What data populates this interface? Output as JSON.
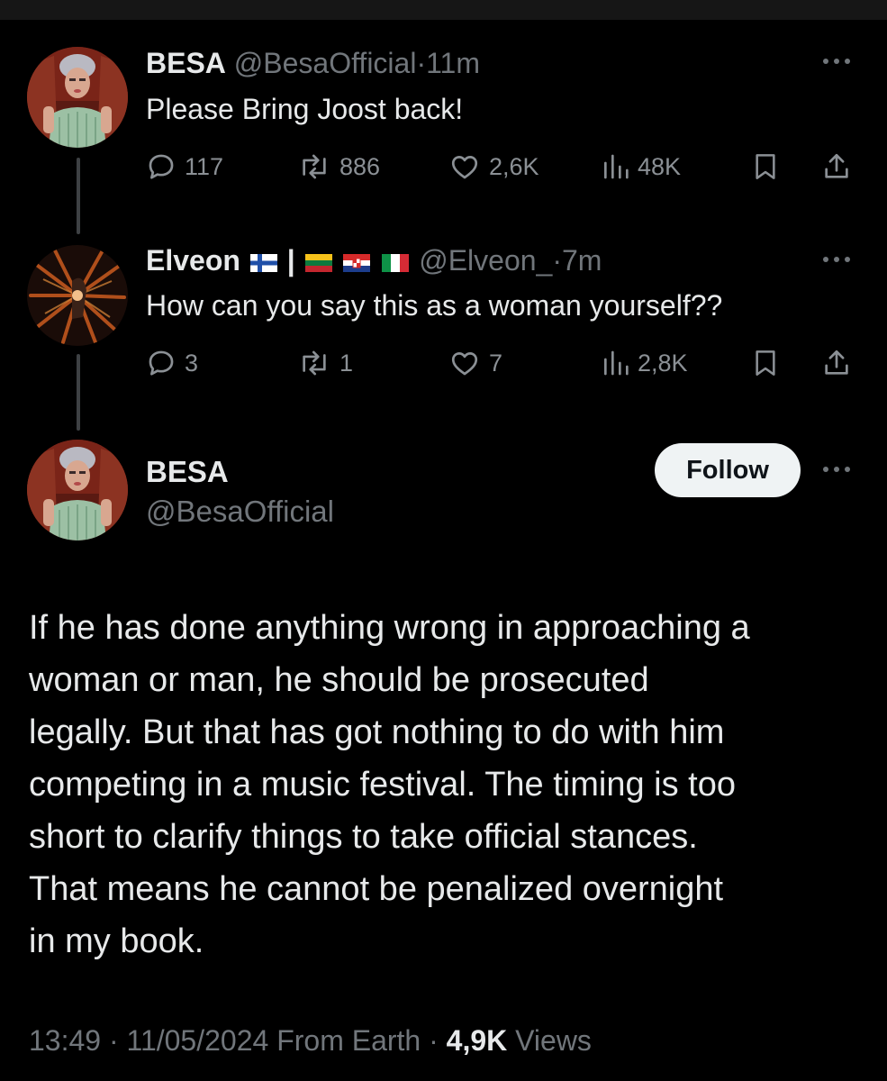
{
  "tweet1": {
    "name": "BESA",
    "handle": "@BesaOfficial",
    "time": "11m",
    "text": "Please Bring Joost back!",
    "stats": {
      "replies": "117",
      "reposts": "886",
      "likes": "2,6K",
      "views": "48K"
    }
  },
  "tweet2": {
    "name": "Elveon",
    "separator": "|",
    "flags": [
      "finland-flag",
      "lithuania-flag",
      "croatia-flag",
      "italy-flag"
    ],
    "handle": "@Elveon_",
    "time": "7m",
    "text": "How can you say this as a woman yourself??",
    "stats": {
      "replies": "3",
      "reposts": "1",
      "likes": "7",
      "views": "2,8K"
    }
  },
  "main": {
    "name": "BESA",
    "handle": "@BesaOfficial",
    "follow_label": "Follow",
    "lines": [
      "If he has done anything wrong in approaching a",
      "woman or man, he should be prosecuted",
      "legally. But that has got nothing to do with him",
      "competing in a music festival. The timing is too",
      "short to clarify things to take official stances.",
      "That means he cannot be penalized overnight",
      "in my book."
    ],
    "meta": {
      "time": "13:49",
      "date": "11/05/2024",
      "source": "From Earth",
      "views_count": "4,9K",
      "views_label": "Views"
    }
  },
  "colors": {
    "background": "#000000",
    "text": "#e7e9ea",
    "muted": "#71767b",
    "button": "#eff3f4"
  }
}
